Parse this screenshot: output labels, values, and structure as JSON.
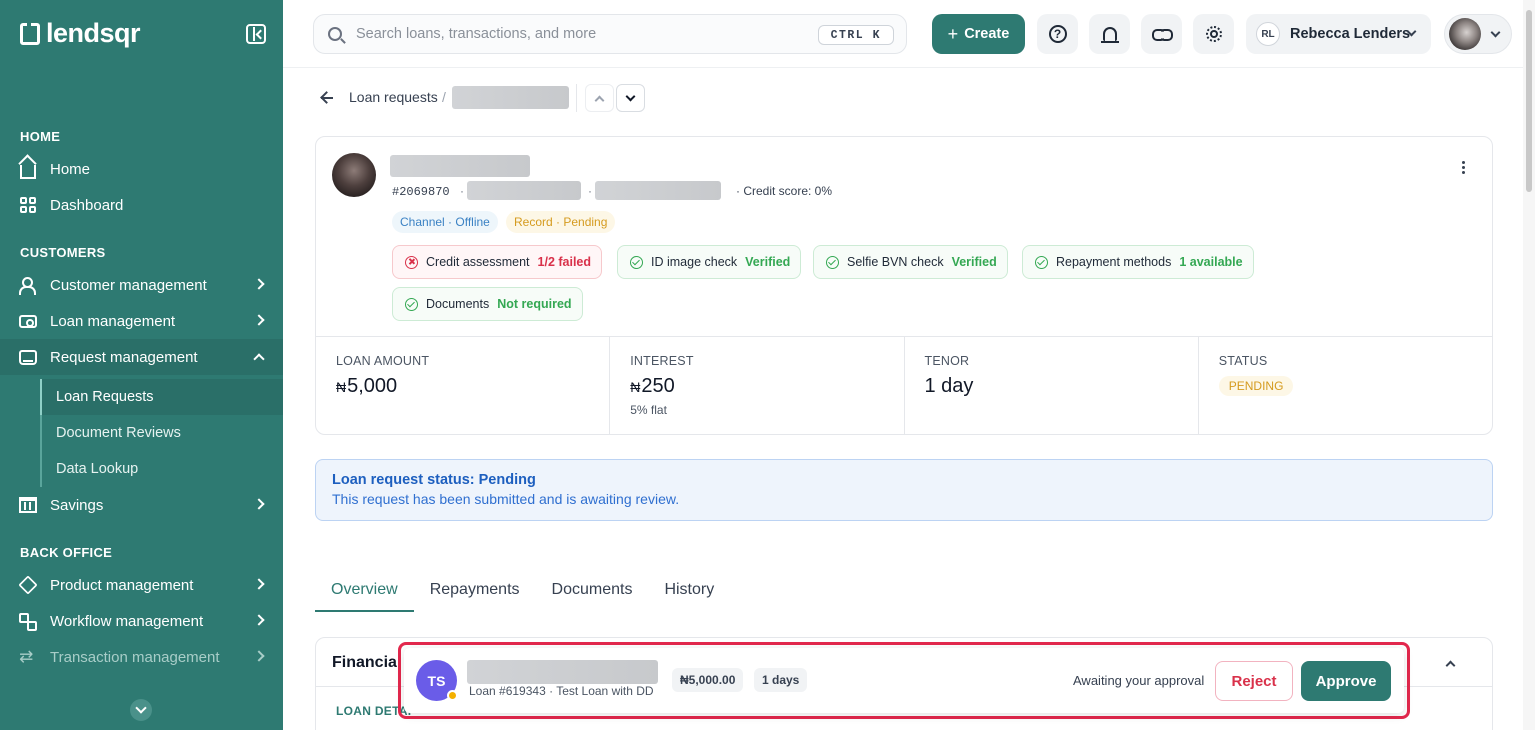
{
  "sidebar": {
    "brand": "lendsqr",
    "sections": {
      "home": "HOME",
      "customers": "CUSTOMERS",
      "back_office": "BACK OFFICE"
    },
    "items": {
      "home": "Home",
      "dashboard": "Dashboard",
      "customer_management": "Customer management",
      "loan_management": "Loan management",
      "request_management": "Request management",
      "savings": "Savings",
      "product_management": "Product management",
      "workflow_management": "Workflow management",
      "transaction_management": "Transaction management"
    },
    "subitems": {
      "loan_requests": "Loan Requests",
      "document_reviews": "Document Reviews",
      "data_lookup": "Data Lookup"
    }
  },
  "topbar": {
    "search_placeholder": "Search loans, transactions, and more",
    "shortcut": "CTRL K",
    "create_label": "Create",
    "user_initials": "RL",
    "user_name": "Rebecca Lenders"
  },
  "breadcrumb": {
    "parent": "Loan requests",
    "separator": "/"
  },
  "profile": {
    "id": "#2069870",
    "credit_score": "· Credit score: 0%",
    "channel_tag": "Channel · Offline",
    "record_tag": "Record · Pending",
    "checks": [
      {
        "label": "Credit assessment",
        "value": "1/2 failed",
        "status": "failed"
      },
      {
        "label": "ID image check",
        "value": "Verified",
        "status": "ok"
      },
      {
        "label": "Selfie BVN check",
        "value": "Verified",
        "status": "ok"
      },
      {
        "label": "Repayment methods",
        "value": "1 available",
        "status": "ok"
      },
      {
        "label": "Documents",
        "value": "Not required",
        "status": "ok"
      }
    ]
  },
  "stats": {
    "loan_amount": {
      "label": "LOAN AMOUNT",
      "currency": "₦",
      "value": "5,000"
    },
    "interest": {
      "label": "INTEREST",
      "currency": "₦",
      "value": "250",
      "sub": "5% flat"
    },
    "tenor": {
      "label": "TENOR",
      "value": "1 day"
    },
    "status": {
      "label": "STATUS",
      "value": "PENDING"
    }
  },
  "alert": {
    "title": "Loan request status: Pending",
    "text": "This request has been submitted and is awaiting review."
  },
  "tabs": [
    "Overview",
    "Repayments",
    "Documents",
    "History"
  ],
  "financial": {
    "title": "Financia",
    "subtitle": "LOAN DETAI"
  },
  "approval": {
    "initials": "TS",
    "loan_info": "Loan #619343 · Test Loan with DD",
    "amount": "₦5,000.00",
    "duration": "1 days",
    "awaiting": "Awaiting your approval",
    "reject_label": "Reject",
    "approve_label": "Approve"
  },
  "colors": {
    "primary": "#2e7a72",
    "danger": "#d9314a",
    "success": "#34a853",
    "warning": "#d59b1f",
    "info": "#1d5fbf"
  }
}
